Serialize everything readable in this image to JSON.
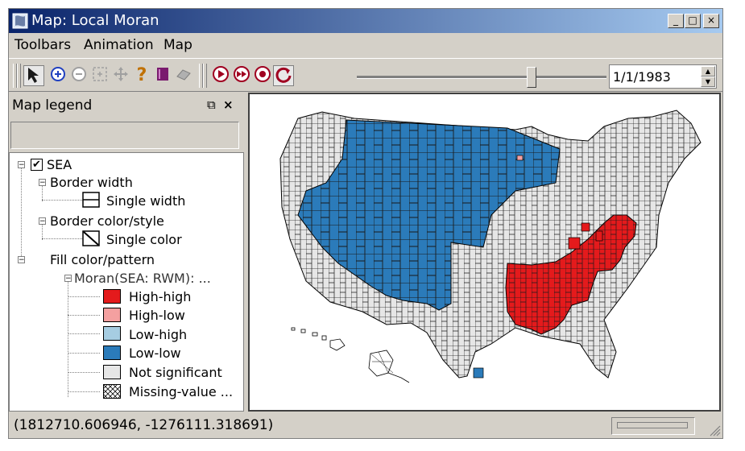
{
  "window": {
    "title": "Map: Local Moran",
    "controls": {
      "minimize": "_",
      "maximize": "□",
      "close": "×"
    }
  },
  "menu": [
    "Toolbars",
    "Animation",
    "Map"
  ],
  "toolbar": {
    "tools": [
      {
        "name": "select-arrow-icon",
        "glyph": "➤"
      },
      {
        "name": "zoom-in-icon",
        "glyph": "⊕"
      },
      {
        "name": "zoom-out-icon",
        "glyph": "⊖"
      },
      {
        "name": "zoom-extent-icon",
        "glyph": "⬚"
      },
      {
        "name": "pan-icon",
        "glyph": "✥"
      },
      {
        "name": "help-icon",
        "glyph": "?"
      },
      {
        "name": "book-icon",
        "glyph": "▮"
      },
      {
        "name": "eraser-icon",
        "glyph": "◆"
      }
    ],
    "animation": [
      {
        "name": "play-icon",
        "glyph": "▶"
      },
      {
        "name": "fast-forward-icon",
        "glyph": "»"
      },
      {
        "name": "stop-icon",
        "glyph": "●"
      },
      {
        "name": "loop-icon",
        "glyph": "↻"
      }
    ],
    "date": "1/1/1983",
    "slider_fraction": 0.7
  },
  "legend": {
    "title": "Map legend",
    "layer": "SEA",
    "items": {
      "border_width": "Border width",
      "border_width_value": "Single width",
      "border_color": "Border color/style",
      "border_color_value": "Single color",
      "fill": "Fill color/pattern",
      "variable": "Moran(SEA: RWM): ..."
    },
    "classes": [
      {
        "label": "High-high",
        "color": "#e41a1c"
      },
      {
        "label": "High-low",
        "color": "#f4a0a0"
      },
      {
        "label": "Low-high",
        "color": "#a6cde2"
      },
      {
        "label": "Low-low",
        "color": "#2b7bba"
      },
      {
        "label": "Not significant",
        "color": "#e6e6e6"
      },
      {
        "label": "Missing-value ...",
        "color": "hatch"
      }
    ]
  },
  "status": {
    "coordinates": "(1812710.606946, -1276111.318691)"
  }
}
